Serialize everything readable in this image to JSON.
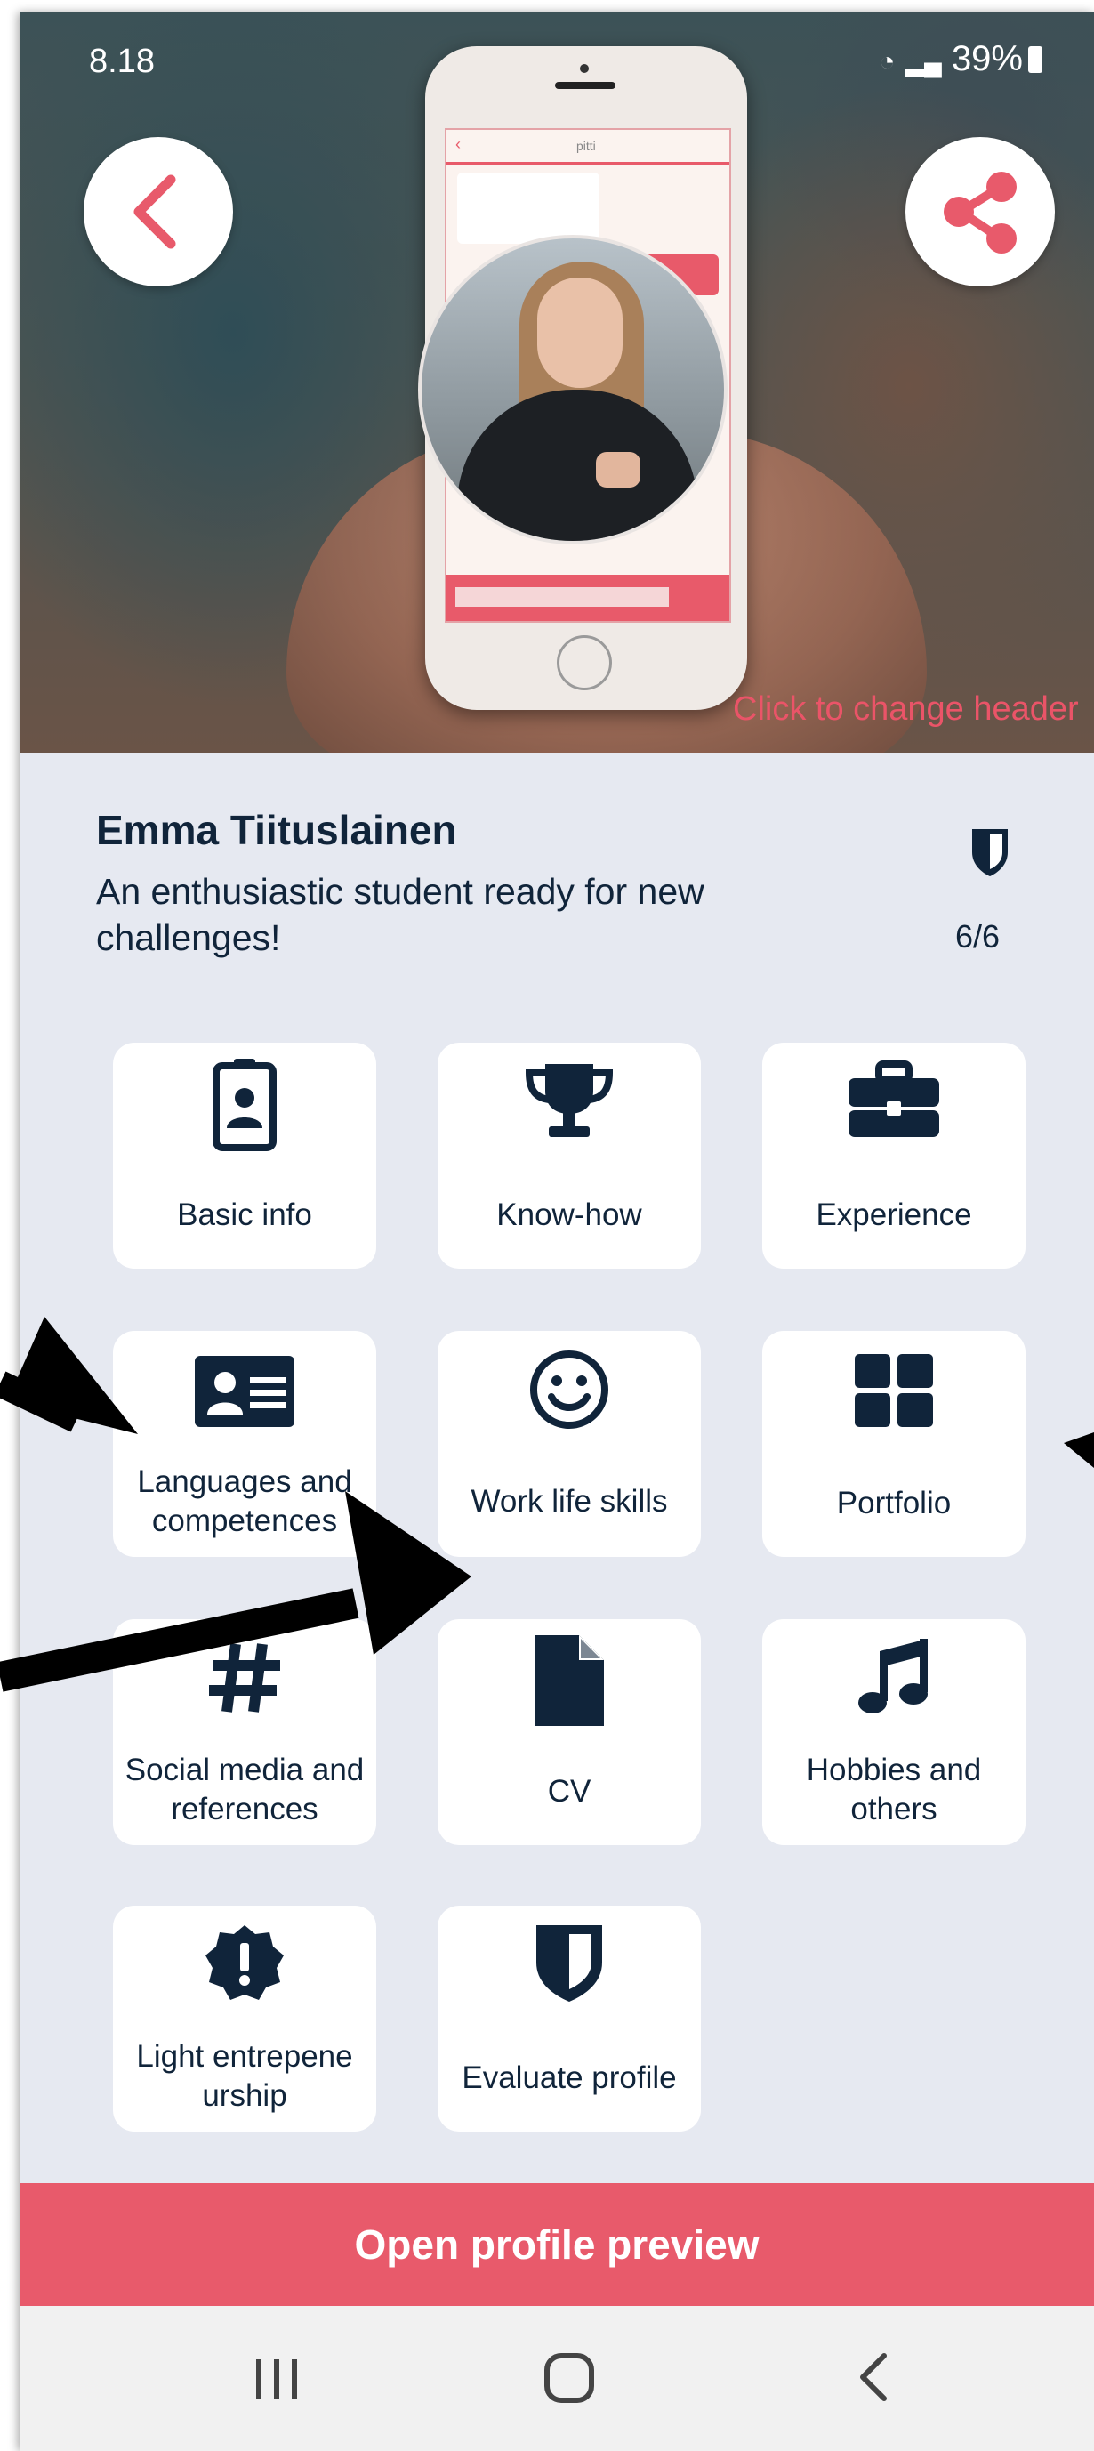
{
  "status_bar": {
    "time": "8.18",
    "battery": "39%"
  },
  "header": {
    "change_hint": "Click to change header"
  },
  "profile": {
    "name": "Emma Tiituslainen",
    "tagline": "An enthusiastic student ready for new challenges!",
    "score": "6/6"
  },
  "tiles": [
    {
      "label": "Basic info",
      "icon": "id-badge-icon"
    },
    {
      "label": "Know-how",
      "icon": "trophy-icon"
    },
    {
      "label": "Experience",
      "icon": "briefcase-icon"
    },
    {
      "label": "Languages and competences",
      "icon": "id-card-icon"
    },
    {
      "label": "Work life skills",
      "icon": "smiley-icon"
    },
    {
      "label": "Portfolio",
      "icon": "grid-icon"
    },
    {
      "label": "Social media and references",
      "icon": "hashtag-icon"
    },
    {
      "label": "CV",
      "icon": "document-icon"
    },
    {
      "label": "Hobbies and others",
      "icon": "music-note-icon"
    },
    {
      "label": "Light entrepene urship",
      "icon": "exclamation-badge-icon"
    },
    {
      "label": "Evaluate profile",
      "icon": "shield-icon"
    }
  ],
  "footer": {
    "preview_label": "Open profile preview"
  },
  "colors": {
    "accent": "#e85a6b",
    "navy": "#10243a",
    "background": "#e6e9f1"
  }
}
